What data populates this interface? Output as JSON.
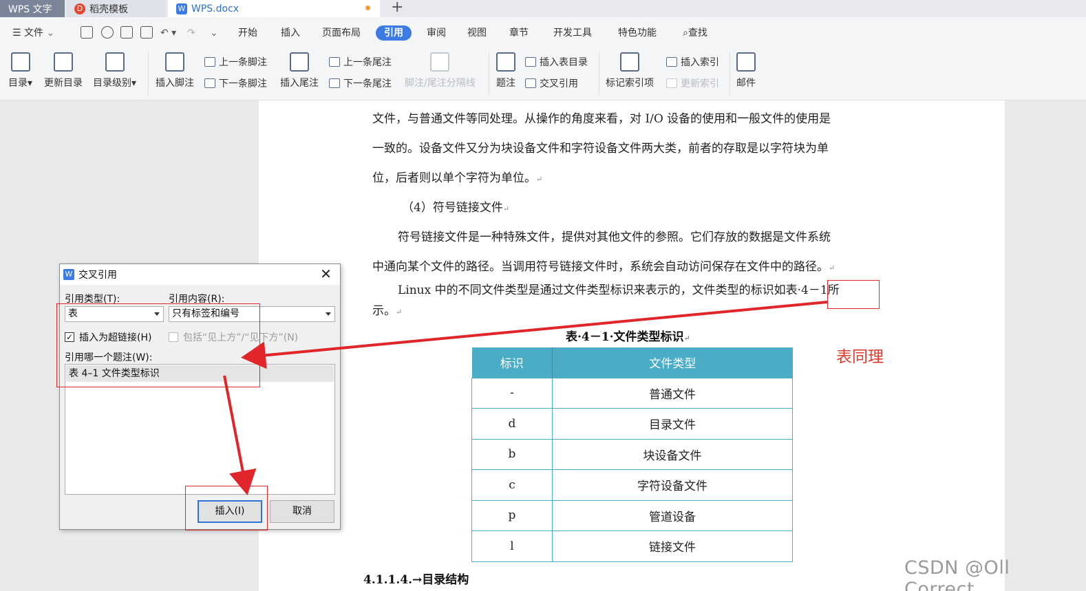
{
  "tabs": {
    "wps": "WPS 文字",
    "template": "稻壳模板",
    "doc": "WPS.docx",
    "new_tab": "+"
  },
  "menu": {
    "file": "文件",
    "items": [
      "开始",
      "插入",
      "页面布局",
      "引用",
      "审阅",
      "视图",
      "章节",
      "开发工具",
      "特色功能"
    ],
    "search": "查找",
    "active": "引用"
  },
  "ribbon": {
    "toc": "目录",
    "update_toc": "更新目录",
    "toc_level": "目录级别",
    "insert_footnote": "插入脚注",
    "prev_footnote": "上一条脚注",
    "next_footnote": "下一条脚注",
    "insert_endnote": "插入尾注",
    "prev_endnote": "上一条尾注",
    "next_endnote": "下一条尾注",
    "separator_line": "脚注/尾注分隔线",
    "caption": "题注",
    "insert_table_of_figures": "插入表目录",
    "cross_reference": "交叉引用",
    "mark_index_entry": "标记索引项",
    "insert_index": "插入索引",
    "update_index": "更新索引",
    "mail": "邮件"
  },
  "document": {
    "p1": "文件，与普通文件等同处理。从操作的角度来看，对 I/O 设备的使用和一般文件的使用是",
    "p2": "一致的。设备文件又分为块设备文件和字符设备文件两大类，前者的存取是以字符块为单",
    "p3": "位，后者则以单个字符为单位。",
    "p4": "（4）符号链接文件",
    "p5": "符号链接文件是一种特殊文件，提供对其他文件的参照。它们存放的数据是文件系统",
    "p6": "中通向某个文件的路径。当调用符号链接文件时，系统会自动访问保存在文件中的路径。",
    "p7a": "Linux 中的不同文件类型是通过文件类型标识来表示的，文件类型的标识如",
    "p7ref": "表·4－1",
    "p7b": "所",
    "p8": "示。",
    "table_caption": "表·4－1·文件类型标识",
    "heading": "4.1.1.4.→目录结构",
    "table": {
      "headers": [
        "标识",
        "文件类型"
      ],
      "rows": [
        [
          "-",
          "普通文件"
        ],
        [
          "d",
          "目录文件"
        ],
        [
          "b",
          "块设备文件"
        ],
        [
          "c",
          "字符设备文件"
        ],
        [
          "p",
          "管道设备"
        ],
        [
          "l",
          "链接文件"
        ]
      ]
    }
  },
  "annotation": "表同理",
  "watermark": "CSDN @Oll Correct",
  "dialog": {
    "title": "交叉引用",
    "ref_type_label": "引用类型(T):",
    "ref_type_value": "表",
    "ref_content_label": "引用内容(R):",
    "ref_content_value": "只有标签和编号",
    "hyperlink_label": "插入为超链接(H)",
    "hyperlink_checked": true,
    "above_below_label": "包括“见上方”/“见下方”(N)",
    "which_caption_label": "引用哪一个题注(W):",
    "captions": [
      "表 4–1 文件类型标识"
    ],
    "insert_button": "插入(I)",
    "cancel_button": "取消"
  },
  "colors": {
    "accent": "#3c7be3",
    "table_header": "#4bacc6",
    "annotation_red": "#e0262a"
  }
}
